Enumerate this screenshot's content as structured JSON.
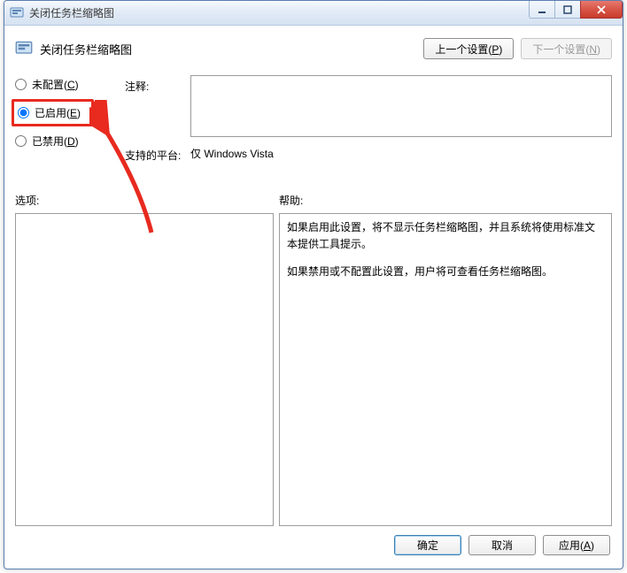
{
  "window": {
    "title": "关闭任务栏缩略图"
  },
  "header": {
    "title": "关闭任务栏缩略图",
    "prev_label": "上一个设置(",
    "prev_mn": "P",
    "prev_label_end": ")",
    "next_label": "下一个设置(",
    "next_mn": "N",
    "next_label_end": ")"
  },
  "radios": {
    "not_configured": "未配置(",
    "not_configured_mn": "C",
    "not_configured_end": ")",
    "enabled": "已启用(",
    "enabled_mn": "E",
    "enabled_end": ")",
    "disabled": "已禁用(",
    "disabled_mn": "D",
    "disabled_end": ")",
    "selected": "enabled"
  },
  "labels": {
    "comment": "注释:",
    "supported": "支持的平台:",
    "options": "选项:",
    "help": "帮助:"
  },
  "comment_value": "",
  "supported_value": "仅 Windows Vista",
  "help_text": {
    "p1": "如果启用此设置，将不显示任务栏缩略图，并且系统将使用标准文本提供工具提示。",
    "p2": "如果禁用或不配置此设置，用户将可查看任务栏缩略图。"
  },
  "buttons": {
    "ok": "确定",
    "cancel": "取消",
    "apply": "应用(",
    "apply_mn": "A",
    "apply_end": ")"
  },
  "icons": {
    "app": "policy-config-icon",
    "header": "policy-config-icon"
  },
  "annotation": {
    "highlight_radio": "enabled",
    "arrow_color": "#e82a1f"
  }
}
